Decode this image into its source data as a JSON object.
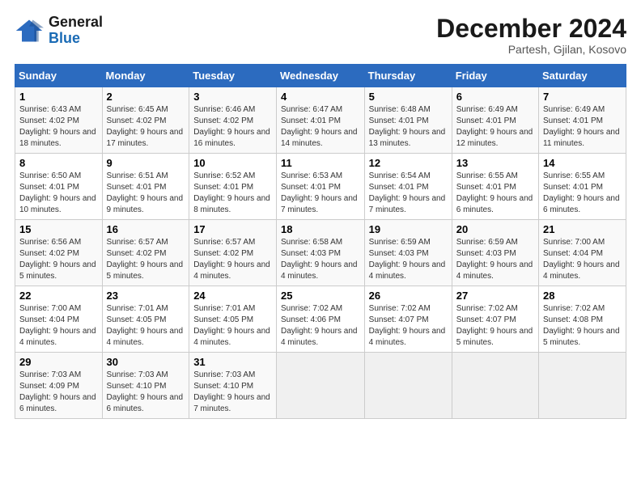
{
  "logo": {
    "line1": "General",
    "line2": "Blue"
  },
  "title": "December 2024",
  "subtitle": "Partesh, Gjilan, Kosovo",
  "days_header": [
    "Sunday",
    "Monday",
    "Tuesday",
    "Wednesday",
    "Thursday",
    "Friday",
    "Saturday"
  ],
  "weeks": [
    [
      {
        "day": "1",
        "sunrise": "6:43 AM",
        "sunset": "4:02 PM",
        "daylight": "9 hours and 18 minutes."
      },
      {
        "day": "2",
        "sunrise": "6:45 AM",
        "sunset": "4:02 PM",
        "daylight": "9 hours and 17 minutes."
      },
      {
        "day": "3",
        "sunrise": "6:46 AM",
        "sunset": "4:02 PM",
        "daylight": "9 hours and 16 minutes."
      },
      {
        "day": "4",
        "sunrise": "6:47 AM",
        "sunset": "4:01 PM",
        "daylight": "9 hours and 14 minutes."
      },
      {
        "day": "5",
        "sunrise": "6:48 AM",
        "sunset": "4:01 PM",
        "daylight": "9 hours and 13 minutes."
      },
      {
        "day": "6",
        "sunrise": "6:49 AM",
        "sunset": "4:01 PM",
        "daylight": "9 hours and 12 minutes."
      },
      {
        "day": "7",
        "sunrise": "6:49 AM",
        "sunset": "4:01 PM",
        "daylight": "9 hours and 11 minutes."
      }
    ],
    [
      {
        "day": "8",
        "sunrise": "6:50 AM",
        "sunset": "4:01 PM",
        "daylight": "9 hours and 10 minutes."
      },
      {
        "day": "9",
        "sunrise": "6:51 AM",
        "sunset": "4:01 PM",
        "daylight": "9 hours and 9 minutes."
      },
      {
        "day": "10",
        "sunrise": "6:52 AM",
        "sunset": "4:01 PM",
        "daylight": "9 hours and 8 minutes."
      },
      {
        "day": "11",
        "sunrise": "6:53 AM",
        "sunset": "4:01 PM",
        "daylight": "9 hours and 7 minutes."
      },
      {
        "day": "12",
        "sunrise": "6:54 AM",
        "sunset": "4:01 PM",
        "daylight": "9 hours and 7 minutes."
      },
      {
        "day": "13",
        "sunrise": "6:55 AM",
        "sunset": "4:01 PM",
        "daylight": "9 hours and 6 minutes."
      },
      {
        "day": "14",
        "sunrise": "6:55 AM",
        "sunset": "4:01 PM",
        "daylight": "9 hours and 6 minutes."
      }
    ],
    [
      {
        "day": "15",
        "sunrise": "6:56 AM",
        "sunset": "4:02 PM",
        "daylight": "9 hours and 5 minutes."
      },
      {
        "day": "16",
        "sunrise": "6:57 AM",
        "sunset": "4:02 PM",
        "daylight": "9 hours and 5 minutes."
      },
      {
        "day": "17",
        "sunrise": "6:57 AM",
        "sunset": "4:02 PM",
        "daylight": "9 hours and 4 minutes."
      },
      {
        "day": "18",
        "sunrise": "6:58 AM",
        "sunset": "4:03 PM",
        "daylight": "9 hours and 4 minutes."
      },
      {
        "day": "19",
        "sunrise": "6:59 AM",
        "sunset": "4:03 PM",
        "daylight": "9 hours and 4 minutes."
      },
      {
        "day": "20",
        "sunrise": "6:59 AM",
        "sunset": "4:03 PM",
        "daylight": "9 hours and 4 minutes."
      },
      {
        "day": "21",
        "sunrise": "7:00 AM",
        "sunset": "4:04 PM",
        "daylight": "9 hours and 4 minutes."
      }
    ],
    [
      {
        "day": "22",
        "sunrise": "7:00 AM",
        "sunset": "4:04 PM",
        "daylight": "9 hours and 4 minutes."
      },
      {
        "day": "23",
        "sunrise": "7:01 AM",
        "sunset": "4:05 PM",
        "daylight": "9 hours and 4 minutes."
      },
      {
        "day": "24",
        "sunrise": "7:01 AM",
        "sunset": "4:05 PM",
        "daylight": "9 hours and 4 minutes."
      },
      {
        "day": "25",
        "sunrise": "7:02 AM",
        "sunset": "4:06 PM",
        "daylight": "9 hours and 4 minutes."
      },
      {
        "day": "26",
        "sunrise": "7:02 AM",
        "sunset": "4:07 PM",
        "daylight": "9 hours and 4 minutes."
      },
      {
        "day": "27",
        "sunrise": "7:02 AM",
        "sunset": "4:07 PM",
        "daylight": "9 hours and 5 minutes."
      },
      {
        "day": "28",
        "sunrise": "7:02 AM",
        "sunset": "4:08 PM",
        "daylight": "9 hours and 5 minutes."
      }
    ],
    [
      {
        "day": "29",
        "sunrise": "7:03 AM",
        "sunset": "4:09 PM",
        "daylight": "9 hours and 6 minutes."
      },
      {
        "day": "30",
        "sunrise": "7:03 AM",
        "sunset": "4:10 PM",
        "daylight": "9 hours and 6 minutes."
      },
      {
        "day": "31",
        "sunrise": "7:03 AM",
        "sunset": "4:10 PM",
        "daylight": "9 hours and 7 minutes."
      },
      null,
      null,
      null,
      null
    ]
  ],
  "labels": {
    "sunrise": "Sunrise:",
    "sunset": "Sunset:",
    "daylight": "Daylight:"
  }
}
